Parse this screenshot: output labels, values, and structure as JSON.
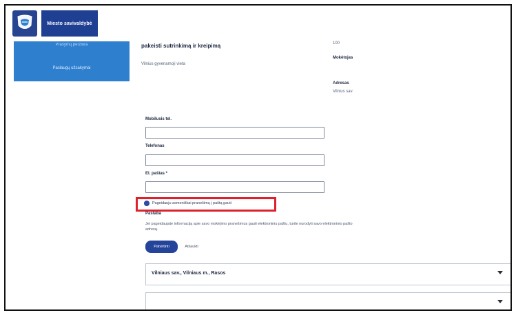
{
  "header": {
    "title": "Miesto savivaldybė"
  },
  "sidebar": {
    "items": [
      {
        "label": "Prašymų peržiūra"
      },
      {
        "label": "Paslaugų užsakymai"
      }
    ]
  },
  "main": {
    "heading": "pakeisti sutrinkimą ir kreipimą",
    "subtext": "Vilnius gyvenamoji vieta",
    "info": {
      "id": "100",
      "label1": "Mokėtojas",
      "label2": "Adresas",
      "value2": "Vilnius sav."
    },
    "fields": [
      {
        "label": "Mobilusis tel.",
        "value": ""
      },
      {
        "label": "Telefonas",
        "value": ""
      },
      {
        "label": "El. paštas *",
        "value": ""
      }
    ],
    "consent_text": "Pageidauju asmeniškai pranešimų į paštą gauti",
    "note": {
      "title": "Pastaba",
      "body": "Jei pageidaujate informaciją apie savo mokėjimo pranešimus gauti elektroniniu paštu, turite nurodyti savo elektroninio pašto adresą."
    },
    "buttons": {
      "primary": "Patvirtinti",
      "secondary": "Atšaukti"
    },
    "accordions": [
      {
        "label": "Vilniaus sav., Vilniaus m., Rasos"
      },
      {
        "label": ""
      }
    ]
  },
  "colors": {
    "accent": "#1f3f93",
    "sidebar": "#2f7fcf",
    "highlight": "#e0212b"
  },
  "icons": {
    "logo": "coat-of-arms-icon",
    "chevron": "chevron-down-icon"
  }
}
